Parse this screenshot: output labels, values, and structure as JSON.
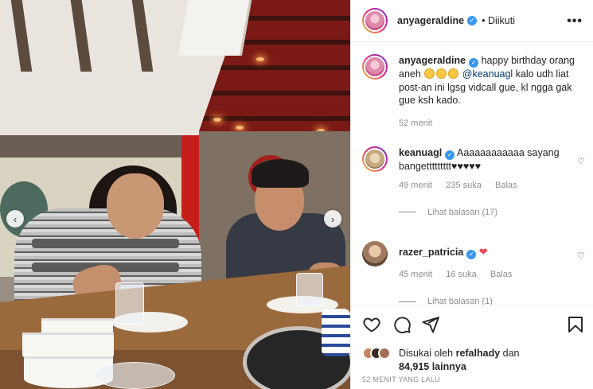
{
  "post": {
    "author": "anyageraldine",
    "follow_status": "Diikuti",
    "more_icon": "more-horizontal-icon",
    "verified_icon": "verified-badge-icon"
  },
  "caption": {
    "username": "anyageraldine",
    "text_before": "happy birthday orang aneh",
    "mention": "@keanuagl",
    "text_after": "kalo udh liat post-an ini lgsg vidcall gue, kl ngga gak gue ksh kado.",
    "time": "52 menit"
  },
  "comments": [
    {
      "username": "keanuagl",
      "text": "Aaaaaaaaaaaa sayang bangettttttttt♥♥♥♥♥",
      "time": "49 menit",
      "likes": "235 suka",
      "reply": "Balas",
      "view_replies": "Lihat balasan (17)"
    },
    {
      "username": "razer_patricia",
      "text": "❤",
      "time": "45 menit",
      "likes": "16 suka",
      "reply": "Balas",
      "view_replies": "Lihat balasan (1)"
    }
  ],
  "likes": {
    "prefix": "Disukai oleh",
    "user": "refalhady",
    "conj": "dan",
    "count": "84,915 lainnya"
  },
  "timestamp": "52 MENIT YANG LALU",
  "icons": [
    "heart-icon",
    "comment-icon",
    "share-icon",
    "bookmark-icon"
  ],
  "colors": {
    "link": "#00376b",
    "muted": "#8e8e8e",
    "verified": "#3897f0",
    "heart": "#ed4956"
  }
}
